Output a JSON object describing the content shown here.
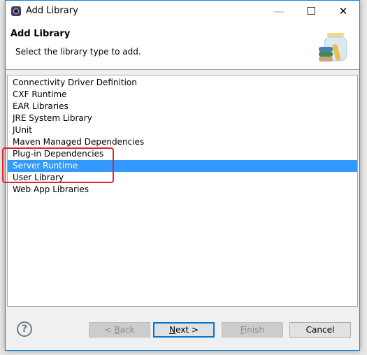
{
  "window": {
    "title": "Add Library",
    "minimize": "—",
    "maximize": "☐",
    "close": "✕"
  },
  "header": {
    "title": "Add Library",
    "description": "Select the library type to add."
  },
  "list": {
    "items": [
      "Connectivity Driver Definition",
      "CXF Runtime",
      "EAR Libraries",
      "JRE System Library",
      "JUnit",
      "Maven Managed Dependencies",
      "Plug-in Dependencies",
      "Server Runtime",
      "User Library",
      "Web App Libraries"
    ],
    "selected": "Server Runtime",
    "selection_color": "#3399ff",
    "highlight_color": "#e3262a"
  },
  "buttons": {
    "help": "?",
    "back_prefix": "< ",
    "back_key": "B",
    "back_rest": "ack",
    "next_key": "N",
    "next_rest": "ext >",
    "finish_key": "F",
    "finish_rest": "inish",
    "cancel": "Cancel"
  }
}
